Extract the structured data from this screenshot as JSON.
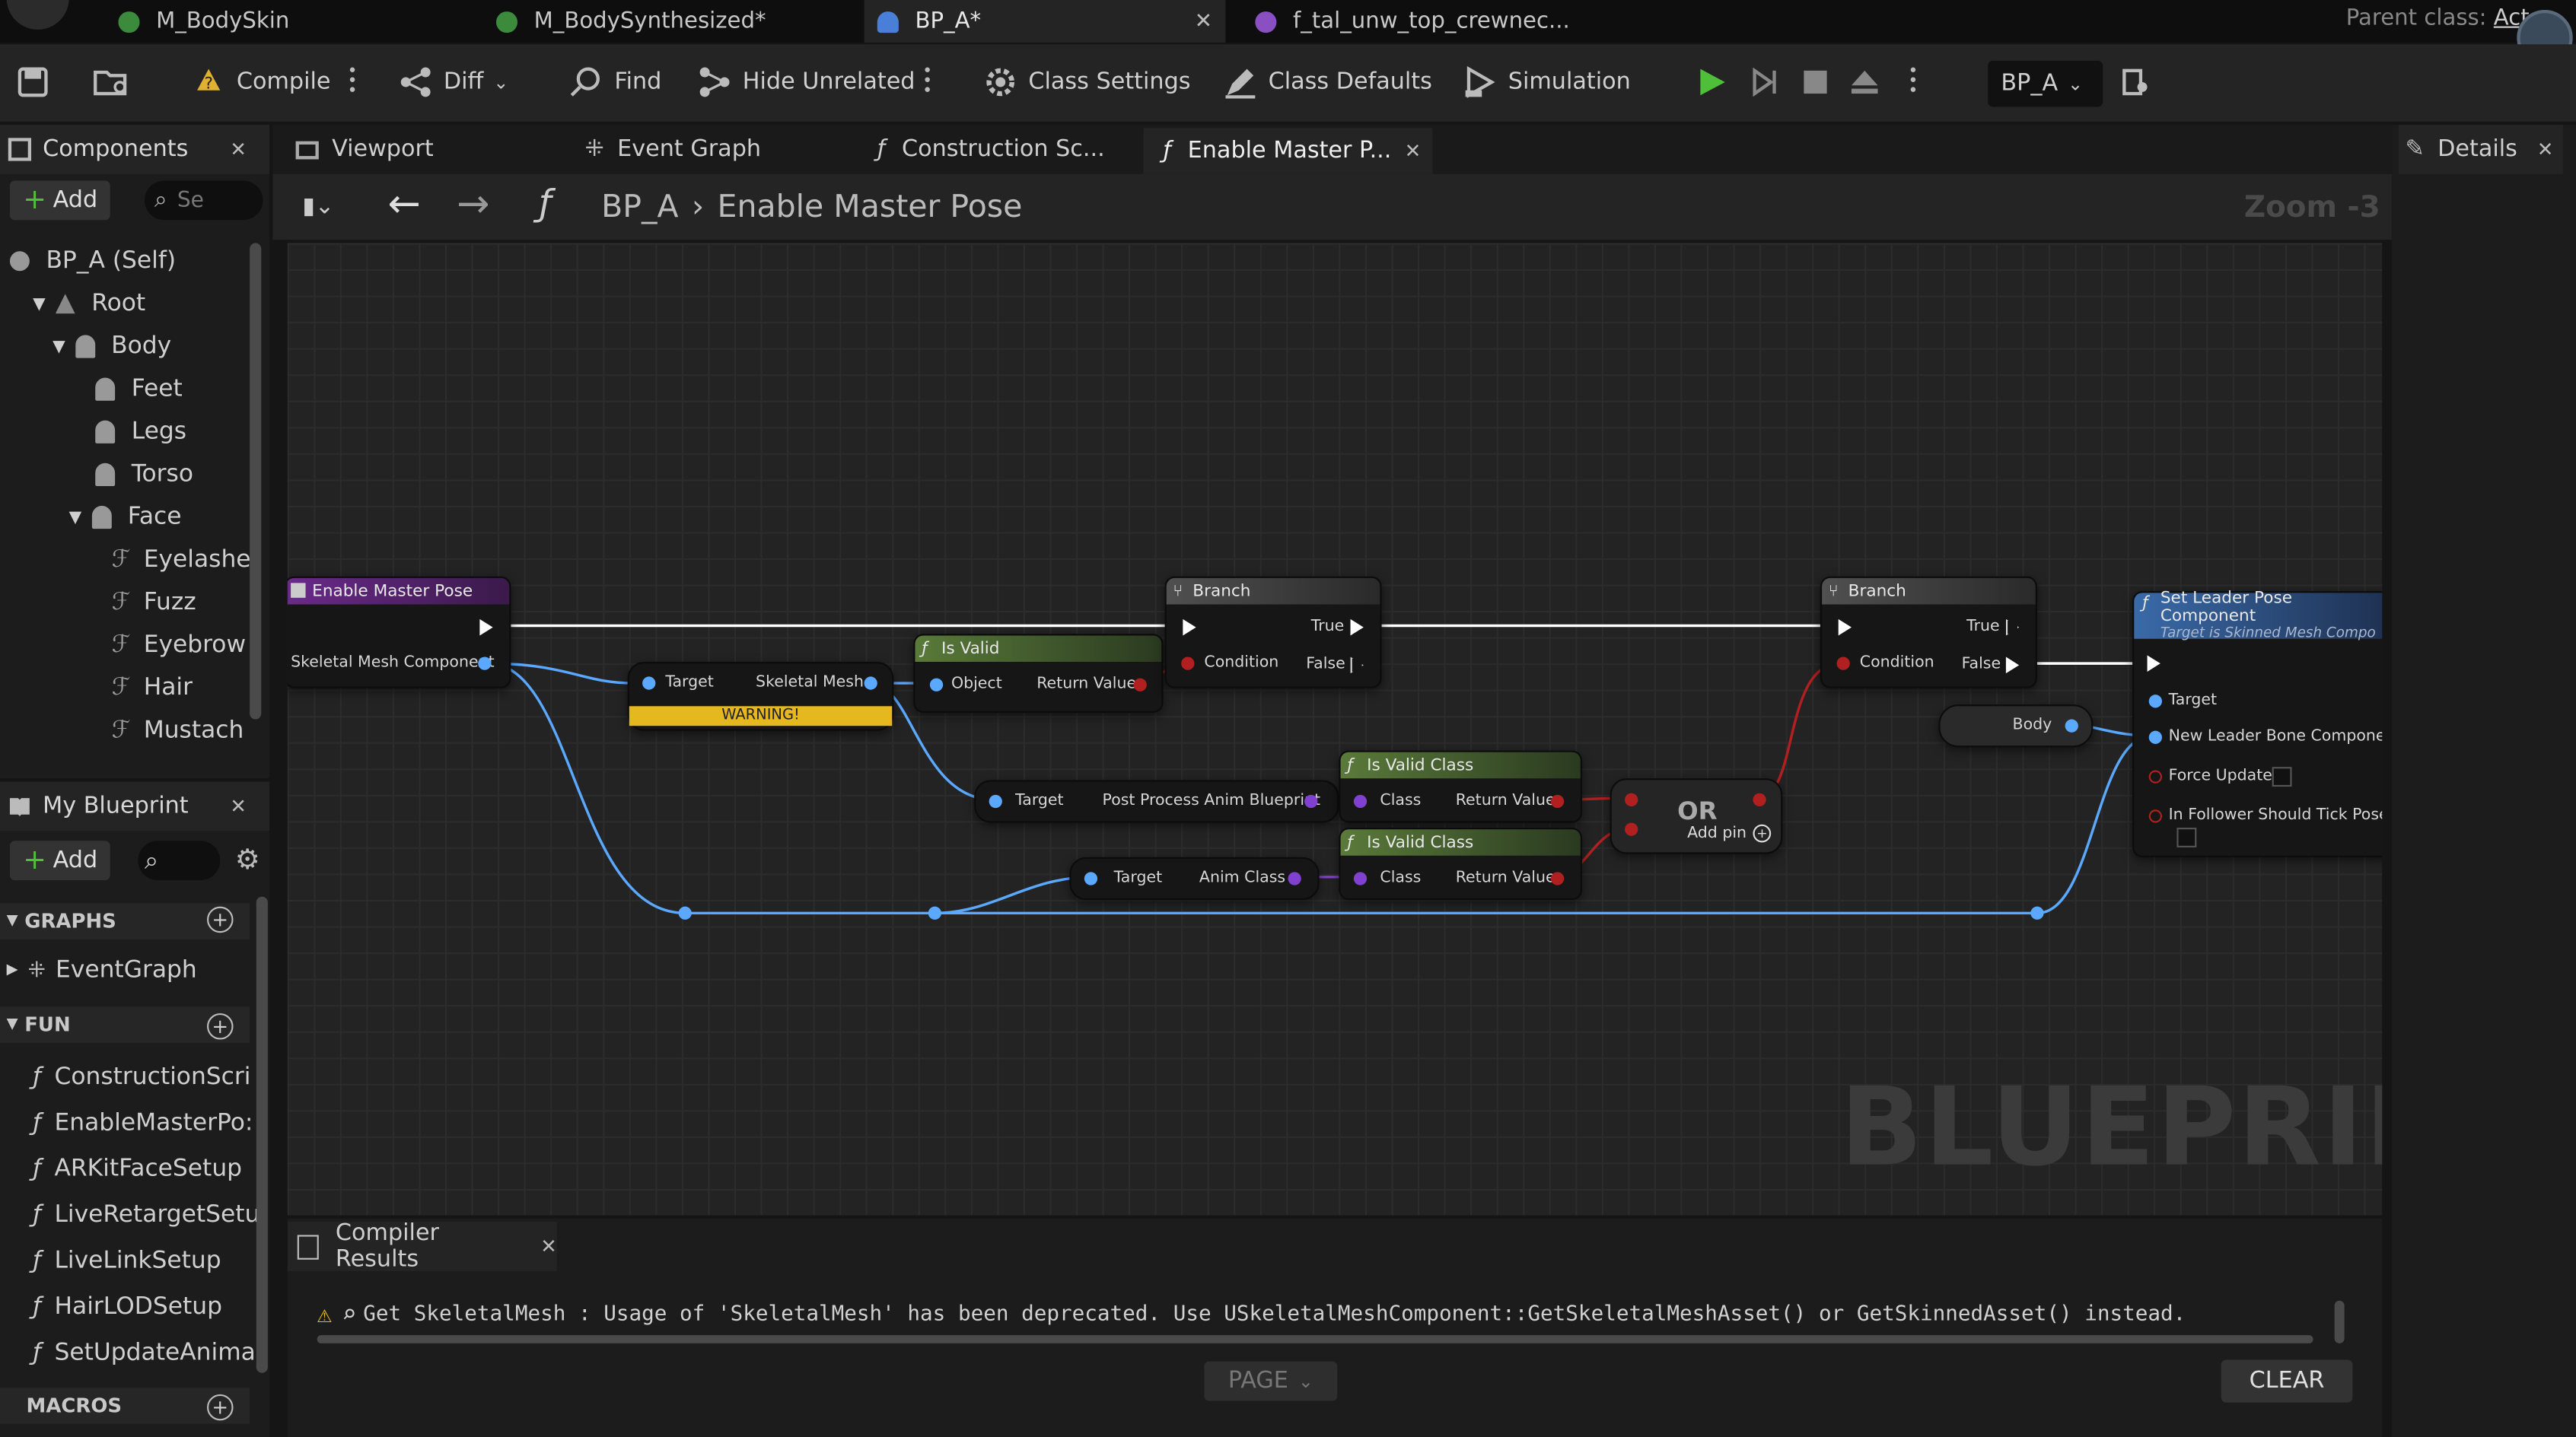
{
  "doc_tabs": [
    {
      "label": "M_BodySkin",
      "icon": "material-icon",
      "color": "#3c8a3c"
    },
    {
      "label": "M_BodySynthesized*",
      "icon": "material-icon",
      "color": "#3c8a3c"
    },
    {
      "label": "BP_A*",
      "icon": "blueprint-icon",
      "color": "#4a7fd8"
    },
    {
      "label": "f_tal_unw_top_crewnec...",
      "icon": "texture-icon",
      "color": "#8a4fc0"
    }
  ],
  "parent_class": {
    "label": "Parent class:",
    "value": "Actor"
  },
  "toolbar": {
    "compile": "Compile",
    "diff": "Diff",
    "find": "Find",
    "hide_unrelated": "Hide Unrelated",
    "class_settings": "Class Settings",
    "class_defaults": "Class Defaults",
    "simulation": "Simulation",
    "blueprint_select": "BP_A"
  },
  "components_panel": {
    "title": "Components",
    "add": "Add",
    "search_placeholder": "Se",
    "tree": [
      {
        "label": "BP_A (Self)",
        "depth": 0,
        "icon": "actor-icon"
      },
      {
        "label": "Root",
        "depth": 1,
        "icon": "scene-icon"
      },
      {
        "label": "Body",
        "depth": 2,
        "icon": "skeletal-mesh-icon"
      },
      {
        "label": "Feet",
        "depth": 3,
        "icon": "skeletal-mesh-icon"
      },
      {
        "label": "Legs",
        "depth": 3,
        "icon": "skeletal-mesh-icon"
      },
      {
        "label": "Torso",
        "depth": 3,
        "icon": "skeletal-mesh-icon"
      },
      {
        "label": "Face",
        "depth": 3,
        "icon": "skeletal-mesh-icon"
      },
      {
        "label": "Eyelashe",
        "depth": 4,
        "icon": "groom-icon"
      },
      {
        "label": "Fuzz",
        "depth": 4,
        "icon": "groom-icon"
      },
      {
        "label": "Eyebrow",
        "depth": 4,
        "icon": "groom-icon"
      },
      {
        "label": "Hair",
        "depth": 4,
        "icon": "groom-icon"
      },
      {
        "label": "Mustach",
        "depth": 4,
        "icon": "groom-icon"
      }
    ]
  },
  "my_blueprint": {
    "title": "My Blueprint",
    "add": "Add",
    "graphs_label": "GRAPHS",
    "eventgraph": "EventGraph",
    "functions_label": "FUN",
    "functions": [
      "ConstructionScri",
      "EnableMasterPo:",
      "ARKitFaceSetup",
      "LiveRetargetSetu",
      "LiveLinkSetup",
      "HairLODSetup",
      "SetUpdateAnima"
    ],
    "macros_label": "MACROS"
  },
  "graph_tabs": [
    {
      "label": "Viewport"
    },
    {
      "label": "Event Graph"
    },
    {
      "label": "Construction Sc..."
    },
    {
      "label": "Enable Master P..."
    }
  ],
  "breadcrumb": {
    "root": "BP_A",
    "current": "Enable Master Pose",
    "zoom": "Zoom -3"
  },
  "details": {
    "title": "Details"
  },
  "nodes": {
    "entry": {
      "title": "Enable Master Pose",
      "pin": "Skeletal Mesh Component"
    },
    "get_mesh": {
      "target": "Target",
      "out": "Skeletal Mesh",
      "warning": "WARNING!"
    },
    "is_valid": {
      "title": "Is Valid",
      "in": "Object",
      "out": "Return Value"
    },
    "branch1": {
      "title": "Branch",
      "true": "True",
      "false": "False",
      "cond": "Condition"
    },
    "branch2": {
      "title": "Branch",
      "true": "True",
      "false": "False",
      "cond": "Condition"
    },
    "ppab": {
      "target": "Target",
      "out": "Post Process Anim Blueprint"
    },
    "animclass": {
      "target": "Target",
      "out": "Anim Class"
    },
    "ivc1": {
      "title": "Is Valid Class",
      "in": "Class",
      "out": "Return Value"
    },
    "ivc2": {
      "title": "Is Valid Class",
      "in": "Class",
      "out": "Return Value"
    },
    "or": {
      "title": "OR",
      "add": "Add pin"
    },
    "body": {
      "label": "Body"
    },
    "slp": {
      "title": "Set Leader Pose Component",
      "subtitle": "Target is Skinned Mesh Compo",
      "target": "Target",
      "leader": "New Leader Bone Component",
      "force": "Force Update",
      "tick": "In Follower Should Tick Pose"
    }
  },
  "watermark": "BLUEPRINT",
  "compiler": {
    "title": "Compiler Results",
    "message": "Get SkeletalMesh : Usage of 'SkeletalMesh' has been deprecated. Use USkeletalMeshComponent::GetSkeletalMeshAsset() or GetSkinnedAsset() instead.",
    "page": "PAGE",
    "clear": "CLEAR"
  }
}
